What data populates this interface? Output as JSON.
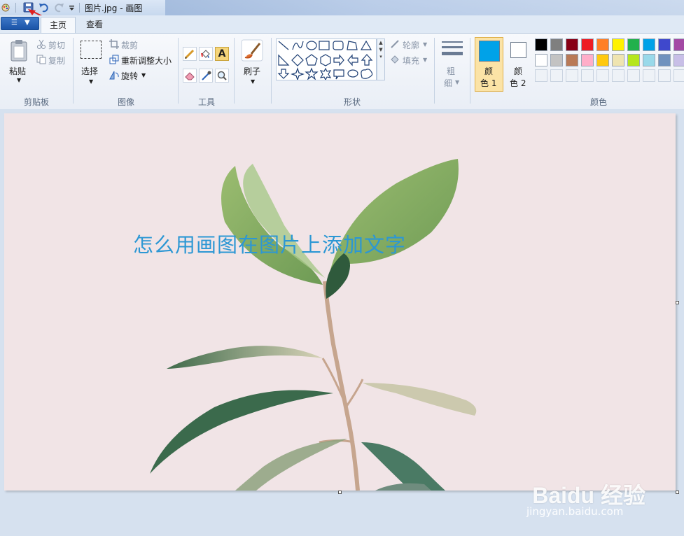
{
  "window": {
    "title": "图片.jpg - 画图"
  },
  "tabs": [
    {
      "label": "主页"
    },
    {
      "label": "查看"
    }
  ],
  "clipboard": {
    "paste": "粘贴",
    "cut": "剪切",
    "copy": "复制",
    "group": "剪贴板"
  },
  "image": {
    "select": "选择",
    "crop": "裁剪",
    "resize": "重新调整大小",
    "rotate": "旋转",
    "group": "图像"
  },
  "tools": {
    "group": "工具",
    "text_tool": "A"
  },
  "brushes": {
    "label": "刷子"
  },
  "shapes": {
    "outline": "轮廓",
    "fill": "填充",
    "group": "形状"
  },
  "size": {
    "label_top": "粗",
    "label_bottom": "细"
  },
  "colors": {
    "color1_top": "颜",
    "color1_bottom": "色 1",
    "color2_top": "颜",
    "color2_bottom": "色 2",
    "group": "颜色",
    "color1": "#00a2e8",
    "color2": "#ffffff",
    "palette_row1": [
      "#000000",
      "#7f7f7f",
      "#880015",
      "#ed1c24",
      "#ff7f27",
      "#fff200",
      "#22b14c",
      "#00a2e8",
      "#3f48cc",
      "#a349a4"
    ],
    "palette_row2": [
      "#ffffff",
      "#c3c3c3",
      "#b97a57",
      "#ffaec9",
      "#ffc90e",
      "#efe4b0",
      "#b5e61d",
      "#99d9ea",
      "#7092be",
      "#c8bfe7"
    ]
  },
  "canvas": {
    "text": "怎么用画图在图片上添加文字"
  },
  "watermark": {
    "brand": "Baidu 经验",
    "url": "jingyan.baidu.com"
  }
}
